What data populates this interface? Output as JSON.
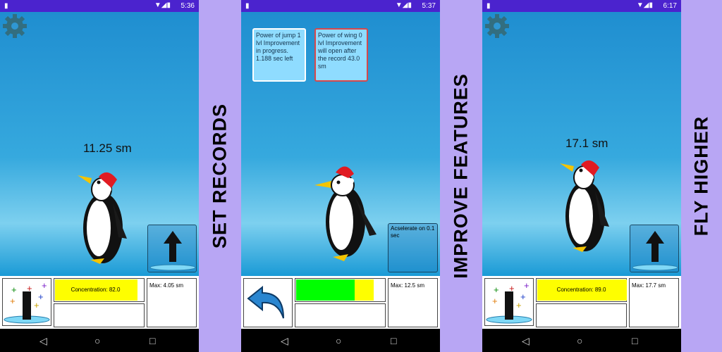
{
  "phones": [
    {
      "status": {
        "time": "5:36"
      },
      "distance": "11.25 sm",
      "concentration": "Concentration: 82.0",
      "max": "Max: 4.05 sm"
    },
    {
      "status": {
        "time": "5:37"
      },
      "upgrades": [
        "Power of jump 1 lvl Improvement in progress. 1.188 sec left",
        "Power of wing 0 lvl Improvement will open after the record 43.0 sm"
      ],
      "accelerate": "Acselerate on 0.1 sec",
      "max": "Max: 12.5 sm",
      "progress": 0.75
    },
    {
      "status": {
        "time": "6:17"
      },
      "distance": "17.1 sm",
      "concentration": "Concentration: 89.0",
      "max": "Max: 17.7 sm"
    }
  ],
  "captions": [
    "SET RECORDS",
    "IMPROVE FEATURES",
    "FLY HIGHER"
  ],
  "colors": {
    "statusbar": "#4b23ce",
    "background": "#b8a6f4",
    "concentration_bar": "#fefe00",
    "progress_bar": "#00ff00"
  }
}
